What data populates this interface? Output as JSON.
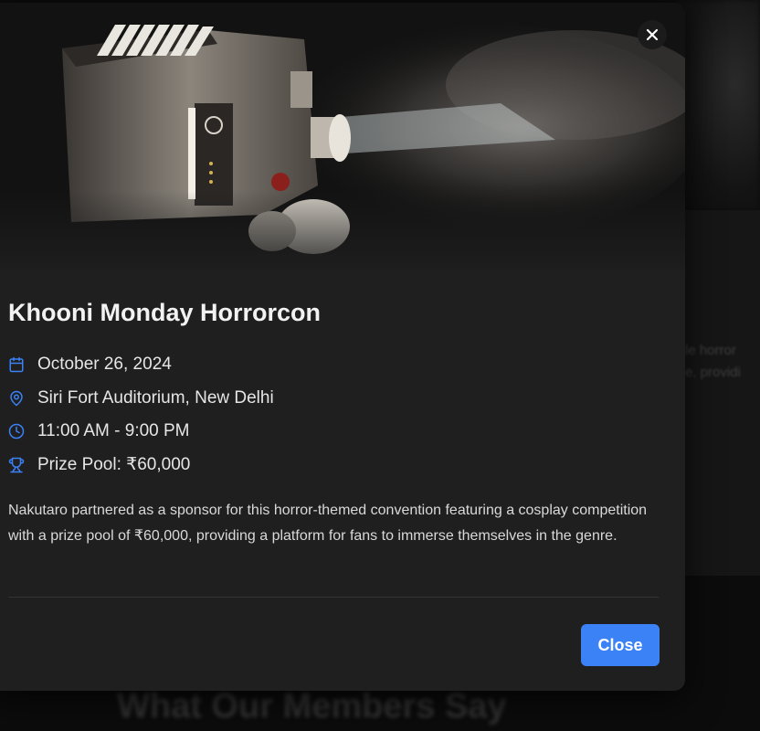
{
  "background": {
    "heading": "What Our Members Say",
    "snippet_lines": [
      "le horror",
      "e, providi"
    ]
  },
  "modal": {
    "close_icon": "close-icon",
    "title": "Khooni Monday Horrorcon",
    "details": [
      {
        "icon": "calendar-icon",
        "text": "October 26, 2024"
      },
      {
        "icon": "map-pin-icon",
        "text": "Siri Fort Auditorium, New Delhi"
      },
      {
        "icon": "clock-icon",
        "text": "11:00 AM - 9:00 PM"
      },
      {
        "icon": "trophy-icon",
        "text": "Prize Pool: ₹60,000"
      }
    ],
    "description": "Nakutaro partnered as a sponsor for this horror-themed convention featuring a cosplay competition with a prize pool of ₹60,000, providing a platform for fans to immerse themselves in the genre.",
    "close_label": "Close",
    "accent_color": "#3b82f6"
  }
}
